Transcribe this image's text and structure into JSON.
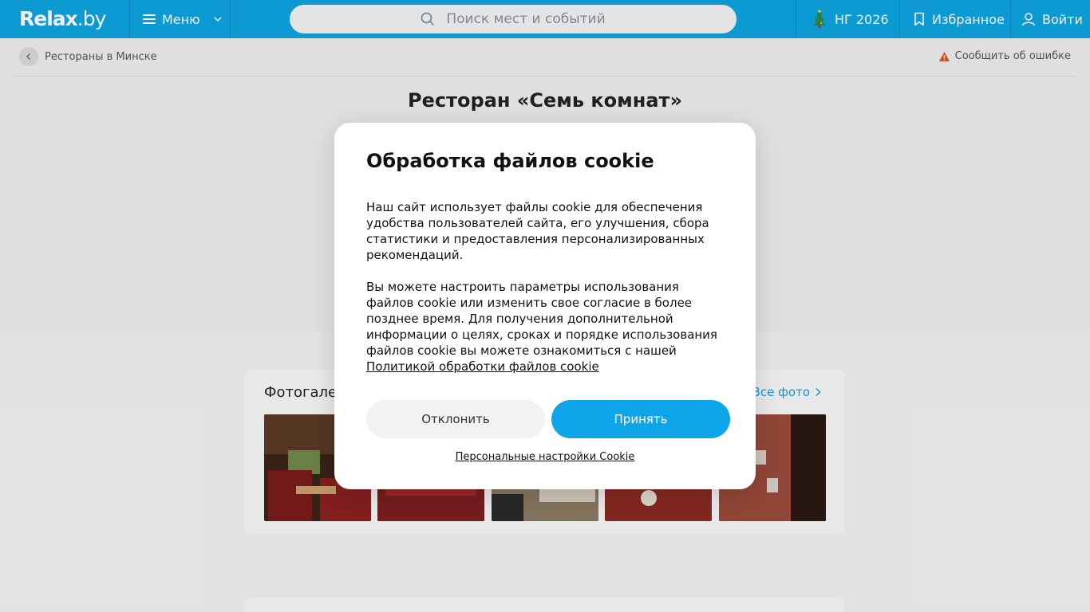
{
  "header": {
    "logo_main": "Relax",
    "logo_suffix": ".by",
    "menu_label": "Меню",
    "search_placeholder": "Поиск мест и событий",
    "ny_label": "НГ 2026",
    "favorites_label": "Избранное",
    "login_label": "Войти",
    "accent_color": "#0ea3e0"
  },
  "breadcrumb": {
    "back_label": "Рестораны в Минске",
    "report_label": "Сообщить об ошибке"
  },
  "page": {
    "title": "Ресторан «Семь комнат»"
  },
  "gallery": {
    "title": "Фотогалерея",
    "all_label": "Все фото",
    "thumbs": [
      "photo-1",
      "photo-2",
      "photo-3",
      "photo-4",
      "photo-5"
    ]
  },
  "cookie_modal": {
    "title": "Обработка файлов cookie",
    "paragraph1": "Наш сайт использует файлы cookie для обеспечения удобства пользователей сайта, его улучшения, сбора статистики и предоставления персонализированных рекомендаций.",
    "paragraph2": "Вы можете настроить параметры использования файлов cookie или изменить свое согласие в более позднее время. Для получения дополнительной информации о целях, сроках и порядке использования файлов cookie вы можете ознакомиться с нашей",
    "policy_link": "Политикой обработки файлов cookie",
    "decline_label": "Отклонить",
    "accept_label": "Принять",
    "settings_label": "Персональные настройки Cookie"
  }
}
